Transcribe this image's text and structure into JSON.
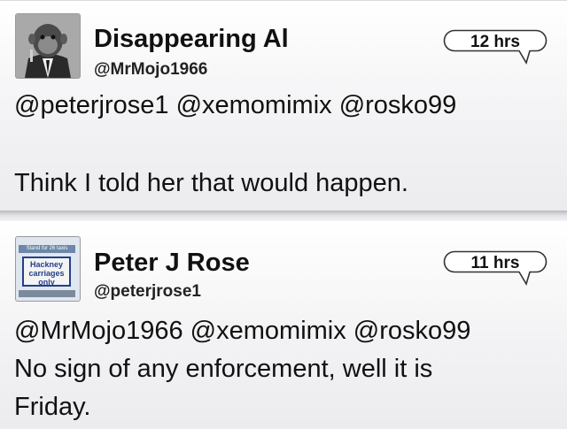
{
  "tweets": [
    {
      "name": "Disappearing Al",
      "handle": "@MrMojo1966",
      "time": "12 hrs",
      "mentions": "@peterjrose1 @xemomimix @rosko99",
      "text": "Think I told her that would happen."
    },
    {
      "name": "Peter J Rose",
      "handle": "@peterjrose1",
      "time": "11 hrs",
      "mentions": "@MrMojo1966 @xemomimix @rosko99",
      "text_line1": "No sign of any enforcement, well it is",
      "text_line2": "Friday.",
      "avatar_sign_top": "Stand for 26 taxis",
      "avatar_sign_text": "Hackney carriages only"
    }
  ],
  "colors": {
    "background": "#f6f6f8",
    "text": "#111111",
    "bubble_border": "#333333"
  },
  "icons": {
    "avatar1": "monkey-in-suit-avatar",
    "avatar2": "taxi-sign-avatar",
    "time_bubble": "speech-bubble-icon"
  }
}
